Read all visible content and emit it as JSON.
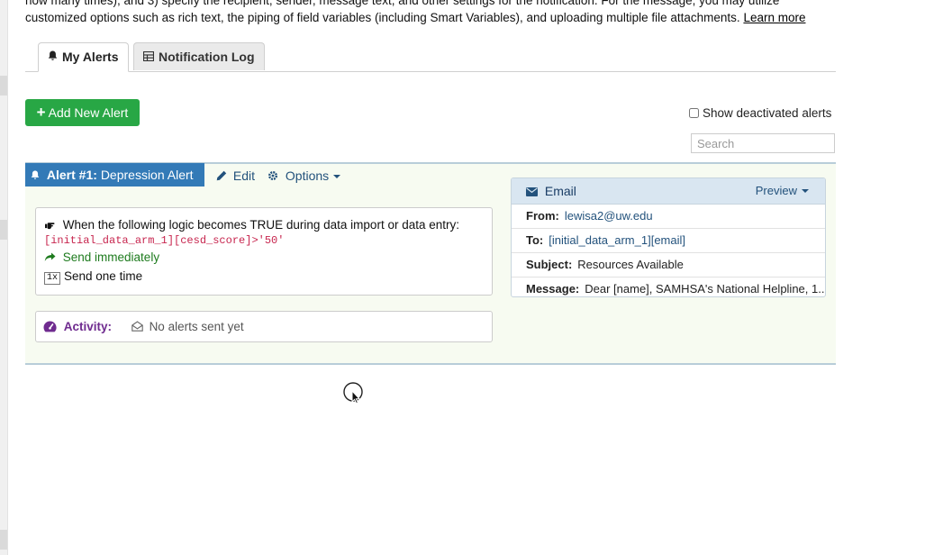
{
  "intro": {
    "line1": "how many times), and 3) specify the recipient, sender, message text, and other settings for the notification. For the message, you may utilize",
    "line2": "customized options such as rich text, the piping of field variables (including Smart Variables), and uploading multiple file attachments.",
    "learn_more": "Learn more"
  },
  "tabs": [
    {
      "label": "My Alerts",
      "icon": "bell-icon"
    },
    {
      "label": "Notification Log",
      "icon": "table-icon"
    }
  ],
  "toolbar": {
    "add_label": "Add New Alert",
    "show_deactivated": "Show deactivated alerts",
    "search_placeholder": "Search"
  },
  "alert": {
    "number_label": "Alert #1:",
    "name": "Depression Alert",
    "edit_label": "Edit",
    "options_label": "Options",
    "trigger_text": "When the following logic becomes TRUE during data import or data entry:",
    "logic": "[initial_data_arm_1][cesd_score]>'50'",
    "send_timing": "Send immediately",
    "once_badge": "1x",
    "send_times": "Send one time",
    "activity_label": "Activity:",
    "activity_value": "No alerts sent yet"
  },
  "email": {
    "type_label": "Email",
    "preview_label": "Preview",
    "from_label": "From:",
    "from_value": "lewisa2@uw.edu",
    "to_label": "To:",
    "to_value": "[initial_data_arm_1][email]",
    "subject_label": "Subject:",
    "subject_value": "Resources Available",
    "message_label": "Message:",
    "message_value": "Dear [name], SAMHSA's National Helpline, 1..."
  },
  "colors": {
    "primary": "#337ab7",
    "success": "#28a745",
    "panel_bg": "#f7fbf1",
    "activity": "#6f2b8f"
  }
}
